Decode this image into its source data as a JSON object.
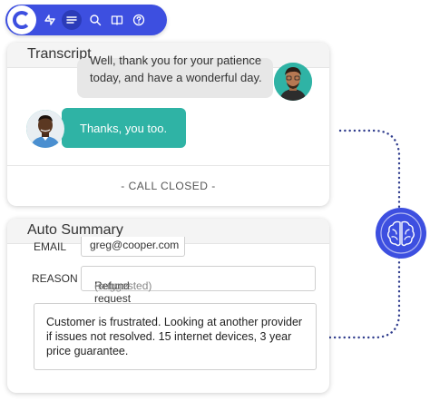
{
  "toolbar": {
    "items": [
      {
        "icon": "activity-icon"
      },
      {
        "icon": "list-icon",
        "active": true
      },
      {
        "icon": "search-icon"
      },
      {
        "icon": "book-icon"
      },
      {
        "icon": "help-icon"
      }
    ],
    "brand_color": "#3d4fe0"
  },
  "transcript": {
    "title": "Transcript",
    "messages": [
      {
        "from": "agent",
        "line1": "Well, thank you for your patience",
        "line2": "today, and have a wonderful day."
      },
      {
        "from": "customer",
        "text": "Thanks, you too."
      }
    ],
    "status": "- CALL CLOSED -",
    "accent_color": "#2fb3a5"
  },
  "summary": {
    "title": "Auto Summary",
    "email_label": "EMAIL",
    "email_value": "greg@cooper.com",
    "reason_label": "REASON",
    "reason_value": "Refund request",
    "reason_hint": "(suggested)",
    "notes": "Customer is frustrated. Looking at another provider if issues not resolved. 15 internet devices, 3 year price guarantee."
  },
  "badge": {
    "icon": "brain-icon"
  }
}
